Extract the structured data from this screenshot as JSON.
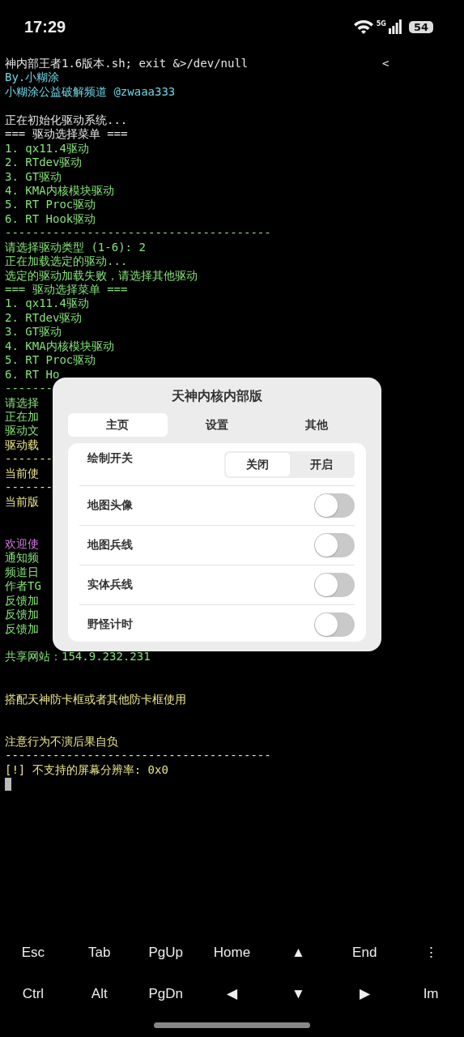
{
  "status_bar": {
    "time": "17:29",
    "network": "5G",
    "battery": "54"
  },
  "terminal": {
    "scroll_marker": "<",
    "lines": [
      {
        "kind": "text",
        "text": "神内部王者1.6版本.sh; exit &>/dev/null",
        "color": "#e6e6e6"
      },
      {
        "kind": "text",
        "text": "By.小糊涂",
        "color": "#6fd6e6"
      },
      {
        "kind": "text",
        "text": "小糊涂公益破解频道 @zwaaa333",
        "color": "#6fd6e6"
      },
      {
        "kind": "blank"
      },
      {
        "kind": "text",
        "text": "正在初始化驱动系统...",
        "color": "#e6e6e6"
      },
      {
        "kind": "text",
        "text": "=== 驱动选择菜单 ===",
        "color": "#e6e6e6"
      },
      {
        "kind": "text",
        "text": "1. qx11.4驱动",
        "color": "#86e27a"
      },
      {
        "kind": "text",
        "text": "2. RTdev驱动",
        "color": "#86e27a"
      },
      {
        "kind": "text",
        "text": "3. GT驱动",
        "color": "#86e27a"
      },
      {
        "kind": "text",
        "text": "4. KMA内核模块驱动",
        "color": "#86e27a"
      },
      {
        "kind": "text",
        "text": "5. RT Proc驱动",
        "color": "#86e27a"
      },
      {
        "kind": "text",
        "text": "6. RT Hook驱动",
        "color": "#86e27a"
      },
      {
        "kind": "text",
        "text": "---------------------------------------",
        "color": "#86e27a"
      },
      {
        "kind": "text",
        "text": "请选择驱动类型 (1-6): 2",
        "color": "#86e27a"
      },
      {
        "kind": "text",
        "text": "正在加载选定的驱动...",
        "color": "#86e27a"
      },
      {
        "kind": "text",
        "text": "选定的驱动加载失败，请选择其他驱动",
        "color": "#86e27a"
      },
      {
        "kind": "text",
        "text": "=== 驱动选择菜单 ===",
        "color": "#86e27a"
      },
      {
        "kind": "text",
        "text": "1. qx11.4驱动",
        "color": "#86e27a"
      },
      {
        "kind": "text",
        "text": "2. RTdev驱动",
        "color": "#86e27a"
      },
      {
        "kind": "text",
        "text": "3. GT驱动",
        "color": "#86e27a"
      },
      {
        "kind": "text",
        "text": "4. KMA内核模块驱动",
        "color": "#86e27a"
      },
      {
        "kind": "text",
        "text": "5. RT Proc驱动",
        "color": "#86e27a"
      },
      {
        "kind": "text",
        "text": "6. RT Ho",
        "color": "#86e27a"
      },
      {
        "kind": "text",
        "text": "-------",
        "color": "#86e27a"
      },
      {
        "kind": "text",
        "text": "请选择",
        "color": "#86e27a"
      },
      {
        "kind": "text",
        "text": "正在加",
        "color": "#86e27a"
      },
      {
        "kind": "text",
        "text": "驱动文",
        "color": "#86e27a"
      },
      {
        "kind": "text",
        "text": "驱动载",
        "color": "#ece58a"
      },
      {
        "kind": "text",
        "text": "-------",
        "color": "#ece58a"
      },
      {
        "kind": "text",
        "text": "当前使",
        "color": "#ece58a"
      },
      {
        "kind": "text",
        "text": "-------",
        "color": "#ece58a"
      },
      {
        "kind": "text",
        "text": "当前版",
        "color": "#ece58a"
      },
      {
        "kind": "blank"
      },
      {
        "kind": "blank"
      },
      {
        "kind": "text",
        "text": "欢迎使",
        "color": "#d77ae6"
      },
      {
        "kind": "text",
        "text": "通知频",
        "color": "#86e27a"
      },
      {
        "kind": "text",
        "text": "频道日",
        "color": "#86e27a"
      },
      {
        "kind": "text",
        "text": "作者TG",
        "color": "#86e27a"
      },
      {
        "kind": "text",
        "text": "反馈加",
        "color": "#86e27a"
      },
      {
        "kind": "text",
        "text": "反馈加",
        "color": "#86e27a"
      },
      {
        "kind": "text",
        "text": "反馈加",
        "color": "#86e27a"
      },
      {
        "kind": "blank"
      },
      {
        "kind": "text",
        "text": "共享网站：154.9.232.231",
        "color": "#86e27a"
      },
      {
        "kind": "blank"
      },
      {
        "kind": "blank"
      },
      {
        "kind": "text",
        "text": "搭配天神防卡框或者其他防卡框使用",
        "color": "#ece58a"
      },
      {
        "kind": "blank"
      },
      {
        "kind": "blank"
      },
      {
        "kind": "text",
        "text": "注意行为不演后果自负",
        "color": "#ece58a"
      },
      {
        "kind": "text",
        "text": "---------------------------------------",
        "color": "#e6e6e6"
      },
      {
        "kind": "text",
        "text": "[!] 不支持的屏幕分辨率: 0x0",
        "color": "#ece58a"
      },
      {
        "kind": "cursor"
      }
    ]
  },
  "dialog": {
    "title": "天神内核内部版",
    "tabs": [
      {
        "label": "主页",
        "selected": true
      },
      {
        "label": "设置",
        "selected": false
      },
      {
        "label": "其他",
        "selected": false
      }
    ],
    "rows": [
      {
        "kind": "segmented",
        "label": "绘制开关",
        "options": [
          {
            "label": "关闭",
            "selected": true
          },
          {
            "label": "开启",
            "selected": false
          }
        ]
      },
      {
        "kind": "toggle",
        "label": "地图头像",
        "on": false
      },
      {
        "kind": "toggle",
        "label": "地图兵线",
        "on": false
      },
      {
        "kind": "toggle",
        "label": "实体兵线",
        "on": false
      },
      {
        "kind": "toggle",
        "label": "野怪计时",
        "on": false
      }
    ]
  },
  "extra_keys": [
    [
      "Esc",
      "Tab",
      "PgUp",
      "Home",
      "▲",
      "End",
      "⋮"
    ],
    [
      "Ctrl",
      "Alt",
      "PgDn",
      "◀",
      "▼",
      "▶",
      "Im"
    ]
  ]
}
